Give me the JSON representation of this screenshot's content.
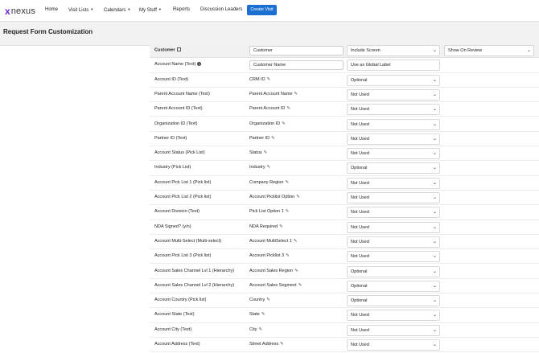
{
  "nav": {
    "logo_x": "x",
    "logo_text": "nexus",
    "items": [
      {
        "label": "Home",
        "caret": false
      },
      {
        "label": "Visit Lists",
        "caret": true
      },
      {
        "label": "Calendars",
        "caret": true
      },
      {
        "label": "My Stuff",
        "caret": true
      },
      {
        "label": "Reports",
        "caret": false
      },
      {
        "label": "Discussion Leaders",
        "caret": false
      }
    ],
    "create_button": "Create Visit"
  },
  "page": {
    "title": "Request Form Customization"
  },
  "header_row": {
    "field": "Customer",
    "label_value": "Customer",
    "screen_option": "Include Screen",
    "review_option": "Show On Review"
  },
  "name_row": {
    "field": "Account Name (Text)",
    "label_value": "Customer Name",
    "global_label": "Use as Global Label"
  },
  "rows": [
    {
      "field": "Account ID (Text)",
      "label": "CRM ID",
      "option": "Optional"
    },
    {
      "field": "Parent Account Name (Text)",
      "label": "Parent Account Name",
      "option": "Not Used"
    },
    {
      "field": "Parent Account ID (Text)",
      "label": "Parent Account ID",
      "option": "Not Used"
    },
    {
      "field": "Organization ID (Text)",
      "label": "Organization ID",
      "option": "Not Used"
    },
    {
      "field": "Partner ID (Text)",
      "label": "Partner ID",
      "option": "Not Used"
    },
    {
      "field": "Account Status (Pick List)",
      "label": "Status",
      "option": "Not Used"
    },
    {
      "field": "Industry (Pick List)",
      "label": "Industry",
      "option": "Optional"
    },
    {
      "field": "Account Pick List 1 (Pick list)",
      "label": "Company Region",
      "option": "Not Used"
    },
    {
      "field": "Account Pick List 2 (Pick list)",
      "label": "Account Picklist Option",
      "option": "Not Used"
    },
    {
      "field": "Account Division (Text)",
      "label": "Pick List Option 1",
      "option": "Not Used"
    },
    {
      "field": "NDA Signed? (y/n)",
      "label": "NDA Required",
      "option": "Not Used"
    },
    {
      "field": "Account Multi-Select (Multi-select)",
      "label": "Account MultiSelect 1",
      "option": "Not Used"
    },
    {
      "field": "Account Pick List 3 (Pick list)",
      "label": "Account Picklist 3",
      "option": "Not Used"
    },
    {
      "field": "Account Sales Channel Lvl 1 (Hierarchy)",
      "label": "Account Sales Region",
      "option": "Optional"
    },
    {
      "field": "Account Sales Channel Lvl 2 (Hierarchy)",
      "label": "Account Sales Segment",
      "option": "Optional"
    },
    {
      "field": "Account Country (Pick list)",
      "label": "Country",
      "option": "Optional"
    },
    {
      "field": "Account State (Text)",
      "label": "State",
      "option": "Not Used"
    },
    {
      "field": "Account City (Text)",
      "label": "City",
      "option": "Not Used"
    },
    {
      "field": "Account Address (Text)",
      "label": "Street Address",
      "option": "Not Used"
    }
  ],
  "colors": {
    "accent": "#1a6fd1",
    "logo": "#6a2bd9",
    "header_band": "#f2f2f2"
  },
  "icons": {
    "pencil": "pencil-icon",
    "chevron": "chevron-down-icon",
    "info": "info-icon",
    "edit": "edit-box-icon"
  }
}
